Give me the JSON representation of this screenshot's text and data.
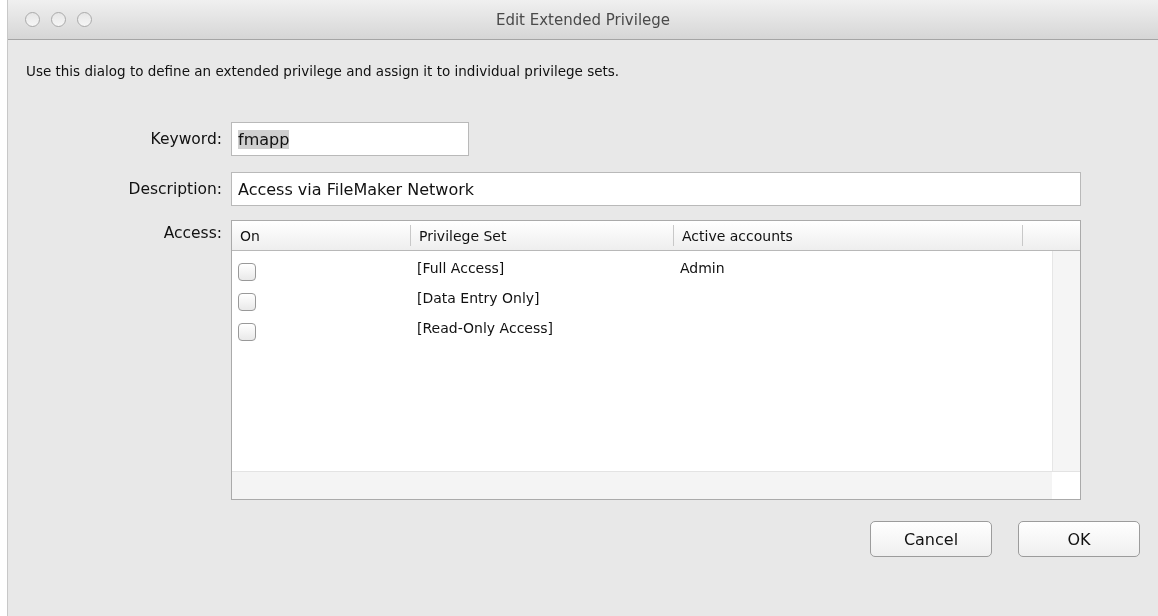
{
  "window": {
    "title": "Edit Extended Privilege"
  },
  "intro": "Use this dialog to define an extended privilege and assign it to individual privilege sets.",
  "keyword": {
    "label": "Keyword:",
    "value": "fmapp",
    "text_selected": true
  },
  "description": {
    "label": "Description:",
    "value": "Access via FileMaker Network"
  },
  "access": {
    "label": "Access:",
    "columns": [
      "On",
      "Privilege Set",
      "Active accounts"
    ],
    "rows": [
      {
        "checked": false,
        "privilege_set": "[Full Access]",
        "active_accounts": "Admin"
      },
      {
        "checked": false,
        "privilege_set": "[Data Entry Only]"
      },
      {
        "checked": false,
        "privilege_set": "[Read-Only Access]"
      }
    ]
  },
  "buttons": [
    "Cancel",
    "OK"
  ]
}
